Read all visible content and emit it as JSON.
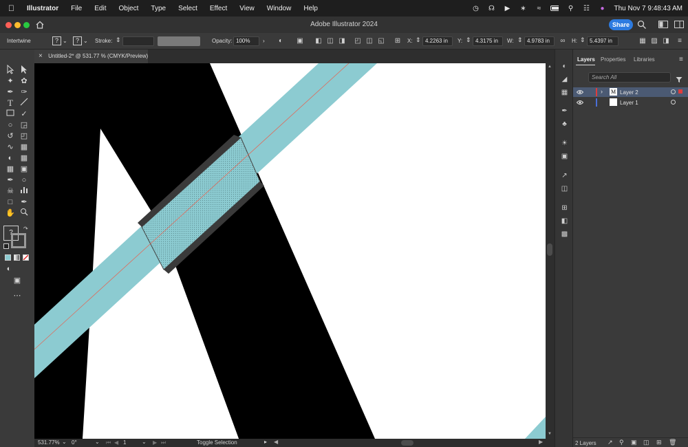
{
  "menubar": {
    "app": "Illustrator",
    "menus": [
      "File",
      "Edit",
      "Object",
      "Type",
      "Select",
      "Effect",
      "View",
      "Window",
      "Help"
    ],
    "datetime": "Thu Nov 7  9:48:43 AM"
  },
  "titlebar": {
    "title": "Adobe Illustrator 2024",
    "share_label": "Share"
  },
  "controlbar": {
    "selection_label": "Intertwine",
    "stroke_label": "Stroke:",
    "opacity_label": "Opacity:",
    "opacity_value": "100%",
    "x_label": "X:",
    "x_value": "4.2263 in",
    "y_label": "Y:",
    "y_value": "4.3175 in",
    "w_label": "W:",
    "w_value": "4.9783 in",
    "h_label": "H:",
    "h_value": "5.4397 in",
    "question_mark": "?"
  },
  "document": {
    "tab_title": "Untitled-2* @ 531.77 % (CMYK/Preview)",
    "close_glyph": "×"
  },
  "statusbar": {
    "zoom": "531.77%",
    "rotation": "0°",
    "artboard": "1",
    "tool": "Toggle Selection"
  },
  "panels": {
    "tabs": [
      "Layers",
      "Properties",
      "Libraries"
    ],
    "search_placeholder": "Search All",
    "layers": [
      {
        "name": "Layer 2",
        "color": "#e03c3c",
        "selected": true
      },
      {
        "name": "Layer 1",
        "color": "#4a6fd8",
        "selected": false
      }
    ],
    "layer_count": "2 Layers"
  },
  "colors": {
    "accent": "#2d7be0",
    "band": "#8ccbd1",
    "path_line": "#e06a5a",
    "letter": "#000000"
  }
}
